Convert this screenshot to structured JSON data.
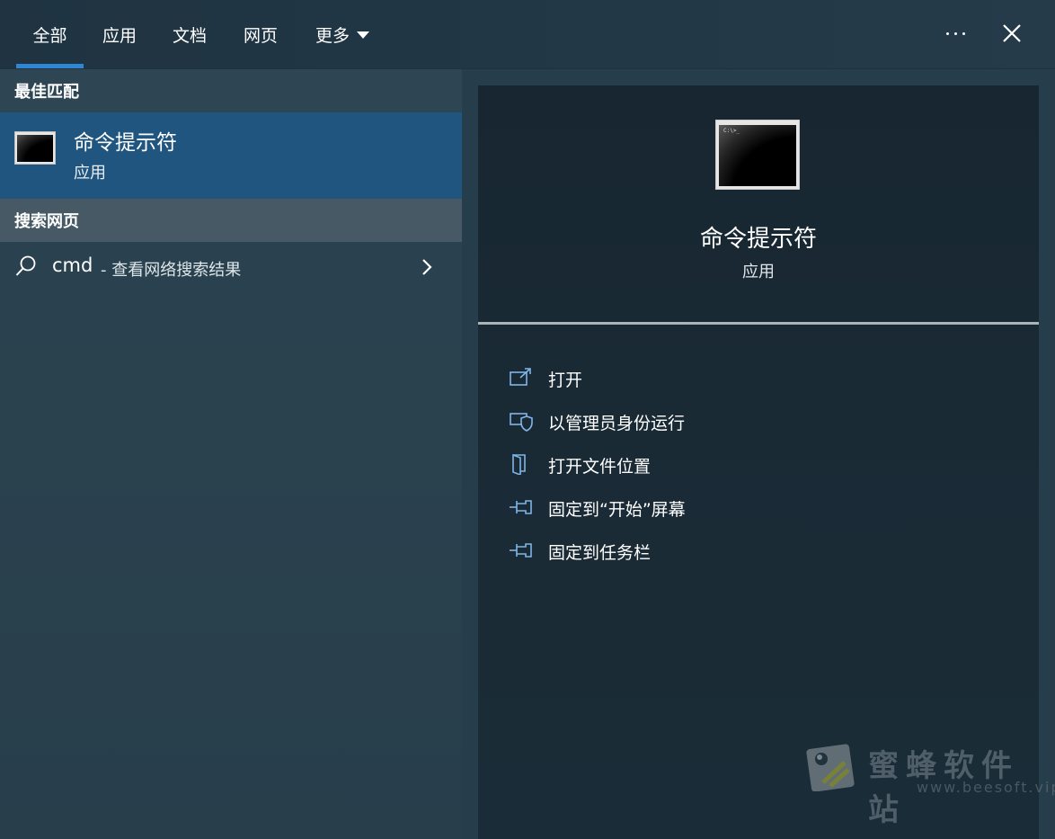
{
  "tabs": [
    {
      "label": "全部",
      "active": true
    },
    {
      "label": "应用",
      "active": false
    },
    {
      "label": "文档",
      "active": false
    },
    {
      "label": "网页",
      "active": false
    },
    {
      "label": "更多",
      "active": false,
      "dropdown": true
    }
  ],
  "topbar": {
    "more_icon": "ellipsis-icon",
    "close_icon": "close-icon"
  },
  "left": {
    "best_match_header": "最佳匹配",
    "best_match": {
      "title": "命令提示符",
      "subtitle": "应用",
      "icon": "cmd-icon"
    },
    "web_header": "搜索网页",
    "web_result": {
      "query": "cmd",
      "description": "- 查看网络搜索结果",
      "icon": "search-icon",
      "arrow_icon": "chevron-right-icon"
    }
  },
  "detail": {
    "title": "命令提示符",
    "subtitle": "应用",
    "icon": "cmd-icon",
    "icon_prompt": "C:\\>_",
    "actions": [
      {
        "label": "打开",
        "icon": "open-external-icon"
      },
      {
        "label": "以管理员身份运行",
        "icon": "shield-icon"
      },
      {
        "label": "打开文件位置",
        "icon": "folder-icon"
      },
      {
        "label": "固定到“开始”屏幕",
        "icon": "pin-icon"
      },
      {
        "label": "固定到任务栏",
        "icon": "pin-icon"
      }
    ]
  },
  "watermark": {
    "name": "蜜蜂软件站",
    "url": "www.beesoft.vip"
  },
  "colors": {
    "accent": "#2f86d3",
    "selected_row": "#205580",
    "icon_blue": "#7fb6e6"
  }
}
